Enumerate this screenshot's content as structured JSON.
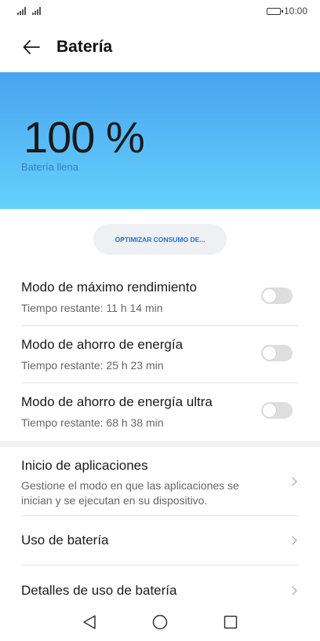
{
  "status_bar": {
    "time": "10:00",
    "battery_level": 1.0,
    "signal_icons": [
      "signal-sim1-icon",
      "signal-sim2-icon"
    ]
  },
  "header": {
    "title": "Batería",
    "back_icon": "arrow-left-icon"
  },
  "hero": {
    "level_text": "100 %",
    "status_text": "Batería llena",
    "gradient_top": "#4aa3f0",
    "gradient_bottom": "#63d2fb"
  },
  "optimize_button": {
    "label": "OPTIMIZAR CONSUMO DE...",
    "color": "#1e73d8"
  },
  "modes": [
    {
      "title": "Modo de máximo rendimiento",
      "subtitle": "Tiempo restante: 11 h 14 min",
      "enabled": false
    },
    {
      "title": "Modo de ahorro de energía",
      "subtitle": "Tiempo restante: 25 h 23 min",
      "enabled": false
    },
    {
      "title": "Modo de ahorro de energía ultra",
      "subtitle": "Tiempo restante: 68 h 38 min",
      "enabled": false
    }
  ],
  "nav_items": [
    {
      "title": "Inicio de aplicaciones",
      "description": "Gestione el modo en que las aplicaciones se inician y se ejecutan en su dispositivo."
    },
    {
      "title": "Uso de batería"
    },
    {
      "title": "Detalles de uso de batería"
    }
  ],
  "system_nav": {
    "back_icon": "triangle-back-icon",
    "home_icon": "circle-home-icon",
    "recents_icon": "square-recents-icon"
  }
}
